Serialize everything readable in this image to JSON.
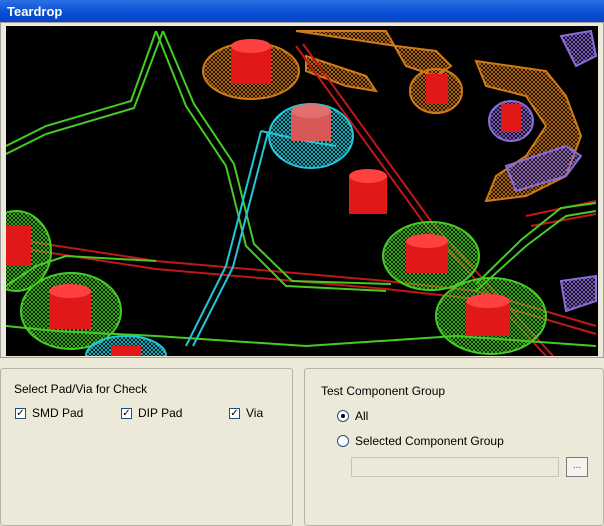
{
  "window": {
    "title": "Teardrop"
  },
  "preview": {
    "description_icon": "pcb-teardrop-preview"
  },
  "pad_check": {
    "title": "Select Pad/Via for Check",
    "options": [
      {
        "label": "SMD Pad",
        "checked": true
      },
      {
        "label": "DIP Pad",
        "checked": true
      },
      {
        "label": "Via",
        "checked": true
      }
    ]
  },
  "component_group": {
    "title": "Test Component Group",
    "options": [
      {
        "label": "All",
        "selected": true
      },
      {
        "label": "Selected Component Group",
        "selected": false
      }
    ],
    "group_field_value": "",
    "browse_label": "..."
  },
  "colors": {
    "title_bar": "#0a4fd6",
    "pad_red": "#e01818",
    "trace_green": "#44cc22",
    "trace_cyan": "#22c6d6",
    "trace_orange": "#d07a16",
    "trace_purple": "#8a6ad8"
  }
}
